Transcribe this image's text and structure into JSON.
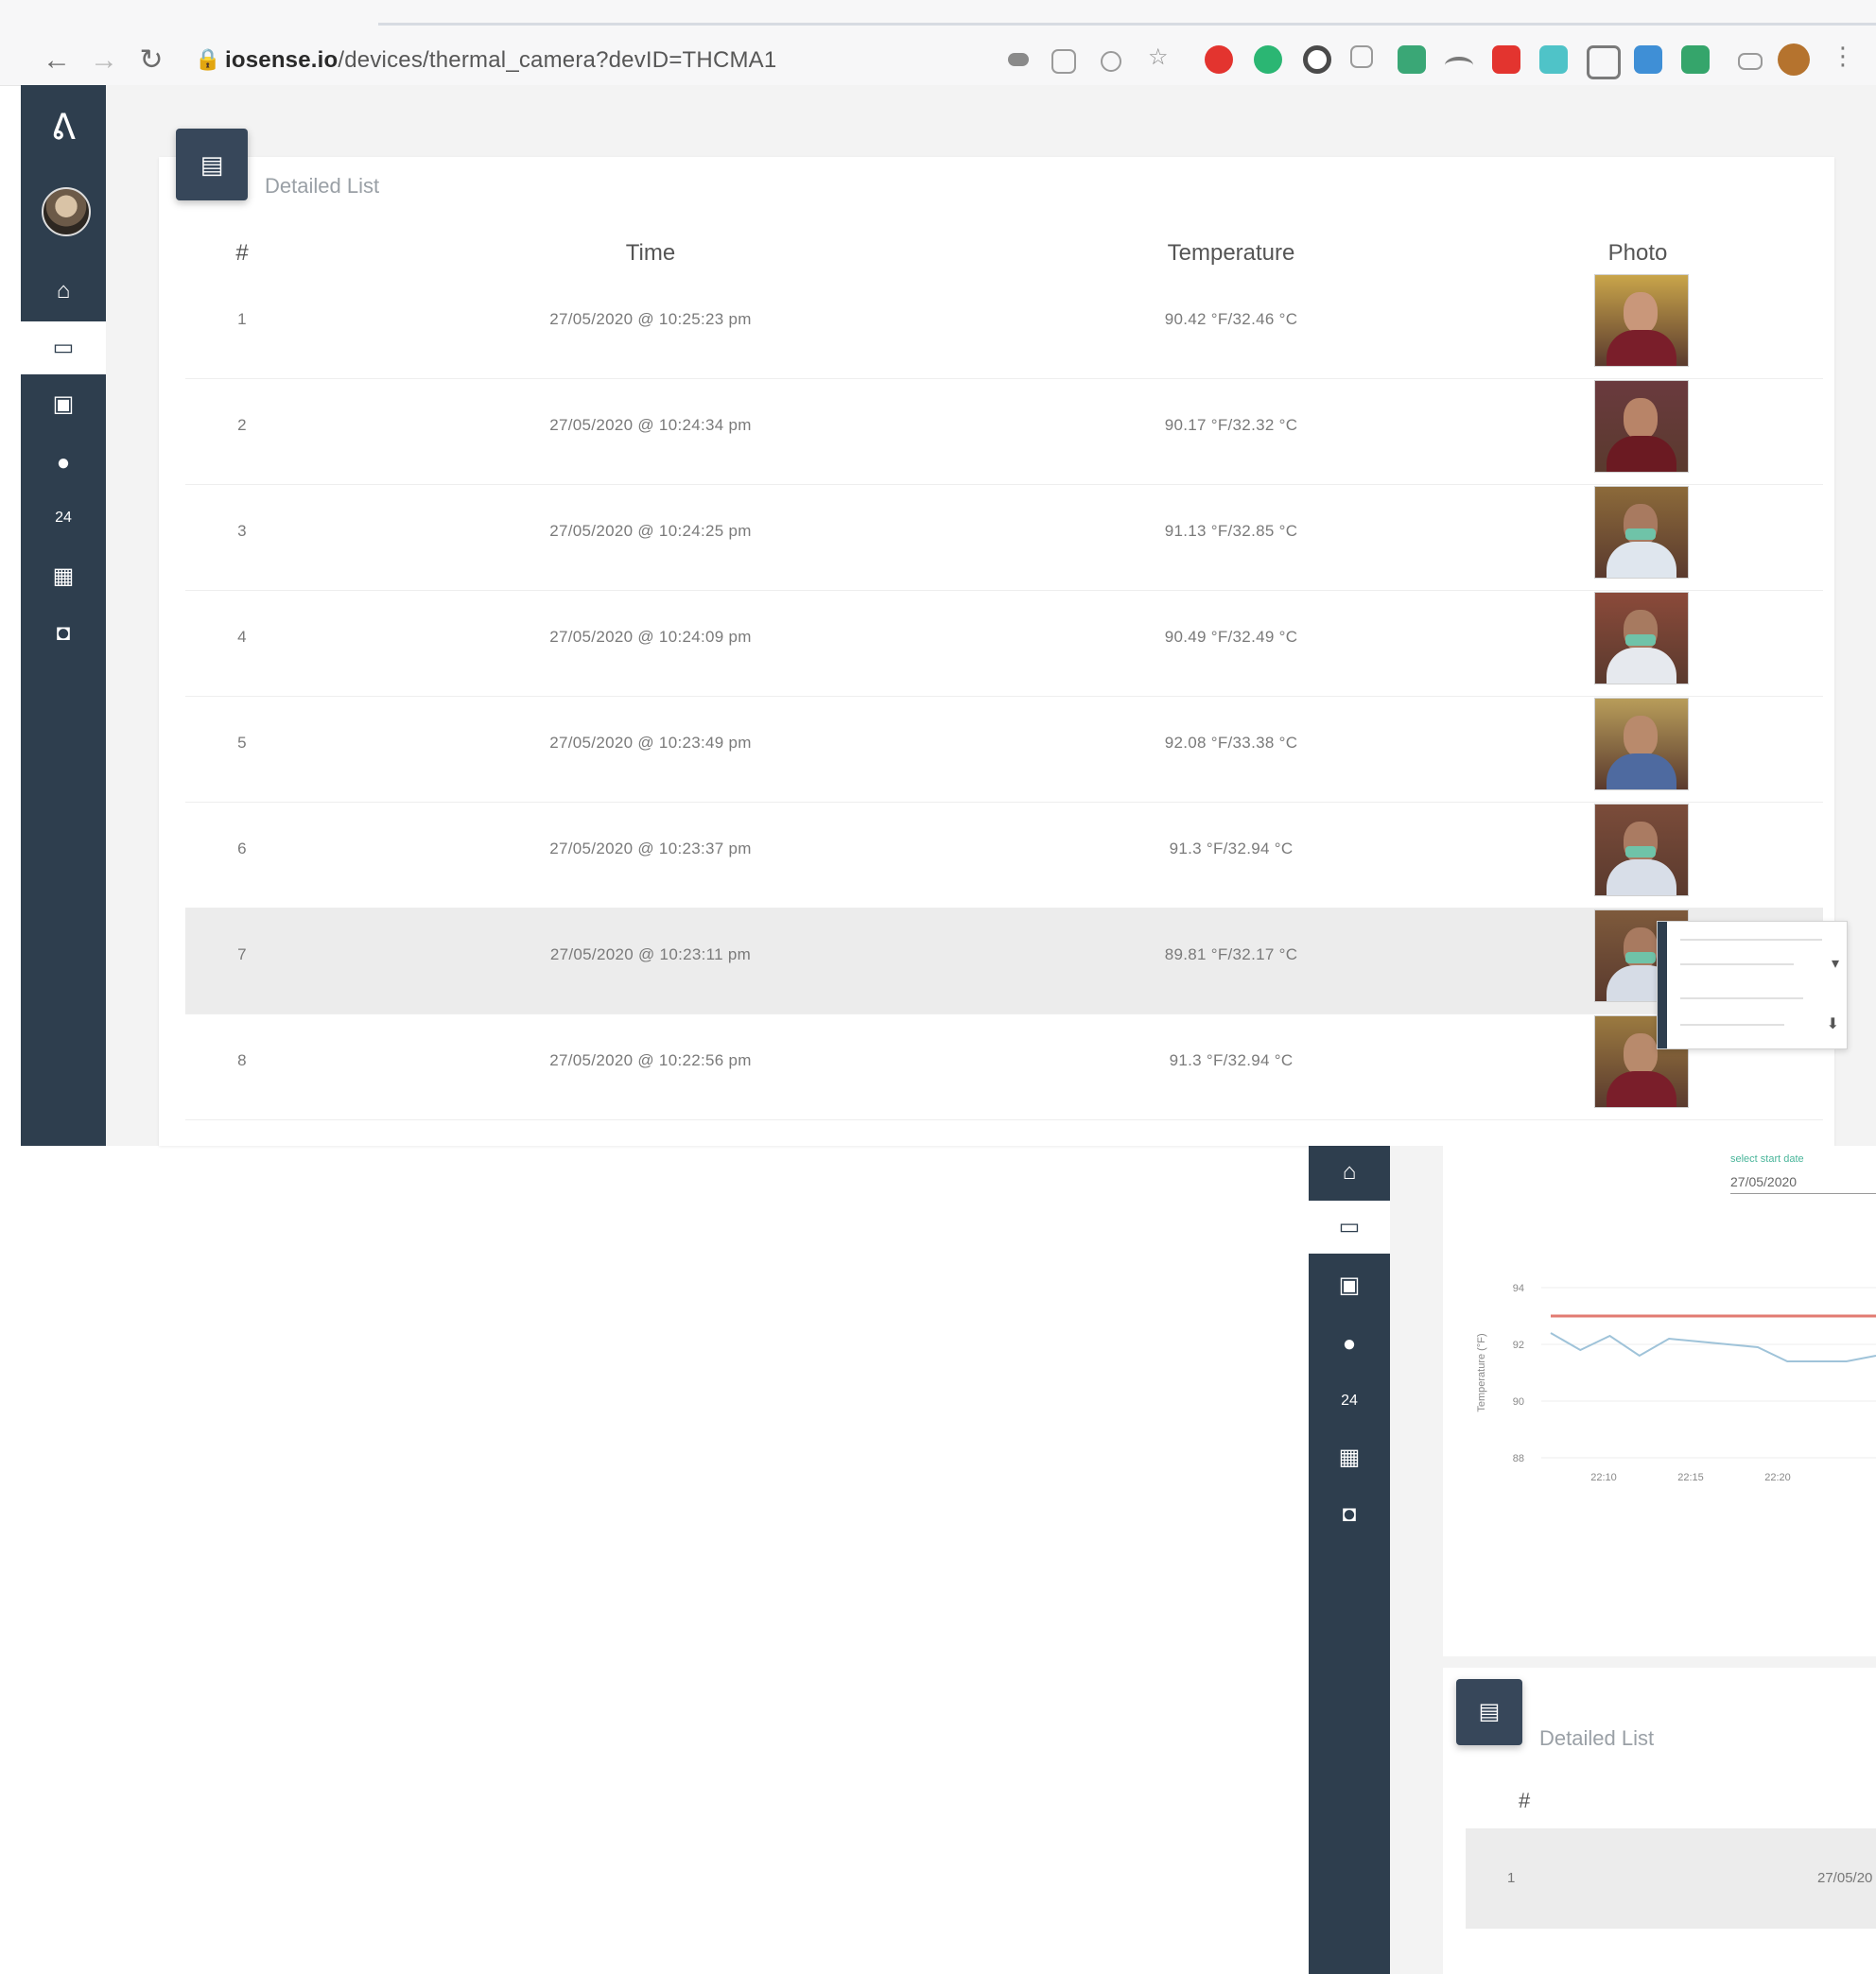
{
  "browser": {
    "url_host": "iosense.io",
    "url_path": "/devices/thermal_camera?devID=THCMA1"
  },
  "sidebar": {
    "items": [
      {
        "icon": "home-icon",
        "glyph": "⌂"
      },
      {
        "icon": "monitor-icon",
        "glyph": "▭",
        "active": true
      },
      {
        "icon": "message-icon",
        "glyph": "▣"
      },
      {
        "icon": "bell-icon",
        "glyph": "●"
      },
      {
        "icon": "24h-icon",
        "glyph": "24"
      },
      {
        "icon": "dashboard-icon",
        "glyph": "▦"
      },
      {
        "icon": "database-icon",
        "glyph": "◘"
      }
    ]
  },
  "detailed_list": {
    "title": "Detailed List",
    "columns": [
      "#",
      "Time",
      "Temperature",
      "Photo"
    ],
    "rows": [
      {
        "n": "1",
        "time": "27/05/2020 @ 10:25:23 pm",
        "temp": "90.42 °F/32.46 °C",
        "highlight": false
      },
      {
        "n": "2",
        "time": "27/05/2020 @ 10:24:34 pm",
        "temp": "90.17 °F/32.32 °C",
        "highlight": false
      },
      {
        "n": "3",
        "time": "27/05/2020 @ 10:24:25 pm",
        "temp": "91.13 °F/32.85 °C",
        "highlight": false
      },
      {
        "n": "4",
        "time": "27/05/2020 @ 10:24:09 pm",
        "temp": "90.49 °F/32.49 °C",
        "highlight": false
      },
      {
        "n": "5",
        "time": "27/05/2020 @ 10:23:49 pm",
        "temp": "92.08 °F/33.38 °C",
        "highlight": false
      },
      {
        "n": "6",
        "time": "27/05/2020 @ 10:23:37 pm",
        "temp": "91.3 °F/32.94 °C",
        "highlight": false
      },
      {
        "n": "7",
        "time": "27/05/2020 @ 10:23:11 pm",
        "temp": "89.81 °F/32.17 °C",
        "highlight": true
      },
      {
        "n": "8",
        "time": "27/05/2020 @ 10:22:56 pm",
        "temp": "91.3 °F/32.94 °C",
        "highlight": false
      }
    ]
  },
  "second_window": {
    "date_label": "select start date",
    "date_value": "27/05/2020",
    "list_title": "Detailed List",
    "list_header": "#",
    "first_row_n": "1",
    "first_row_time": "27/05/20"
  },
  "chart_data": {
    "type": "line",
    "title": "",
    "xlabel": "",
    "ylabel": "Temperature (°F)",
    "y_ticks": [
      "94",
      "92",
      "90",
      "88"
    ],
    "x_ticks": [
      "22:10",
      "22:15",
      "22:20"
    ],
    "ylim": [
      88,
      94
    ],
    "threshold": 93,
    "series": [
      {
        "color": "#e27b72",
        "values": [
          93,
          93,
          93,
          93,
          93,
          93,
          93,
          93,
          93,
          93,
          93,
          93
        ]
      },
      {
        "color": "#9fc3d9",
        "values": [
          92.4,
          91.8,
          92.3,
          91.6,
          92.2,
          92.1,
          92.0,
          91.9,
          91.4,
          91.4,
          91.4,
          91.6
        ]
      }
    ],
    "colors": {
      "threshold": "#e27b72",
      "reading": "#9fc3d9"
    }
  }
}
